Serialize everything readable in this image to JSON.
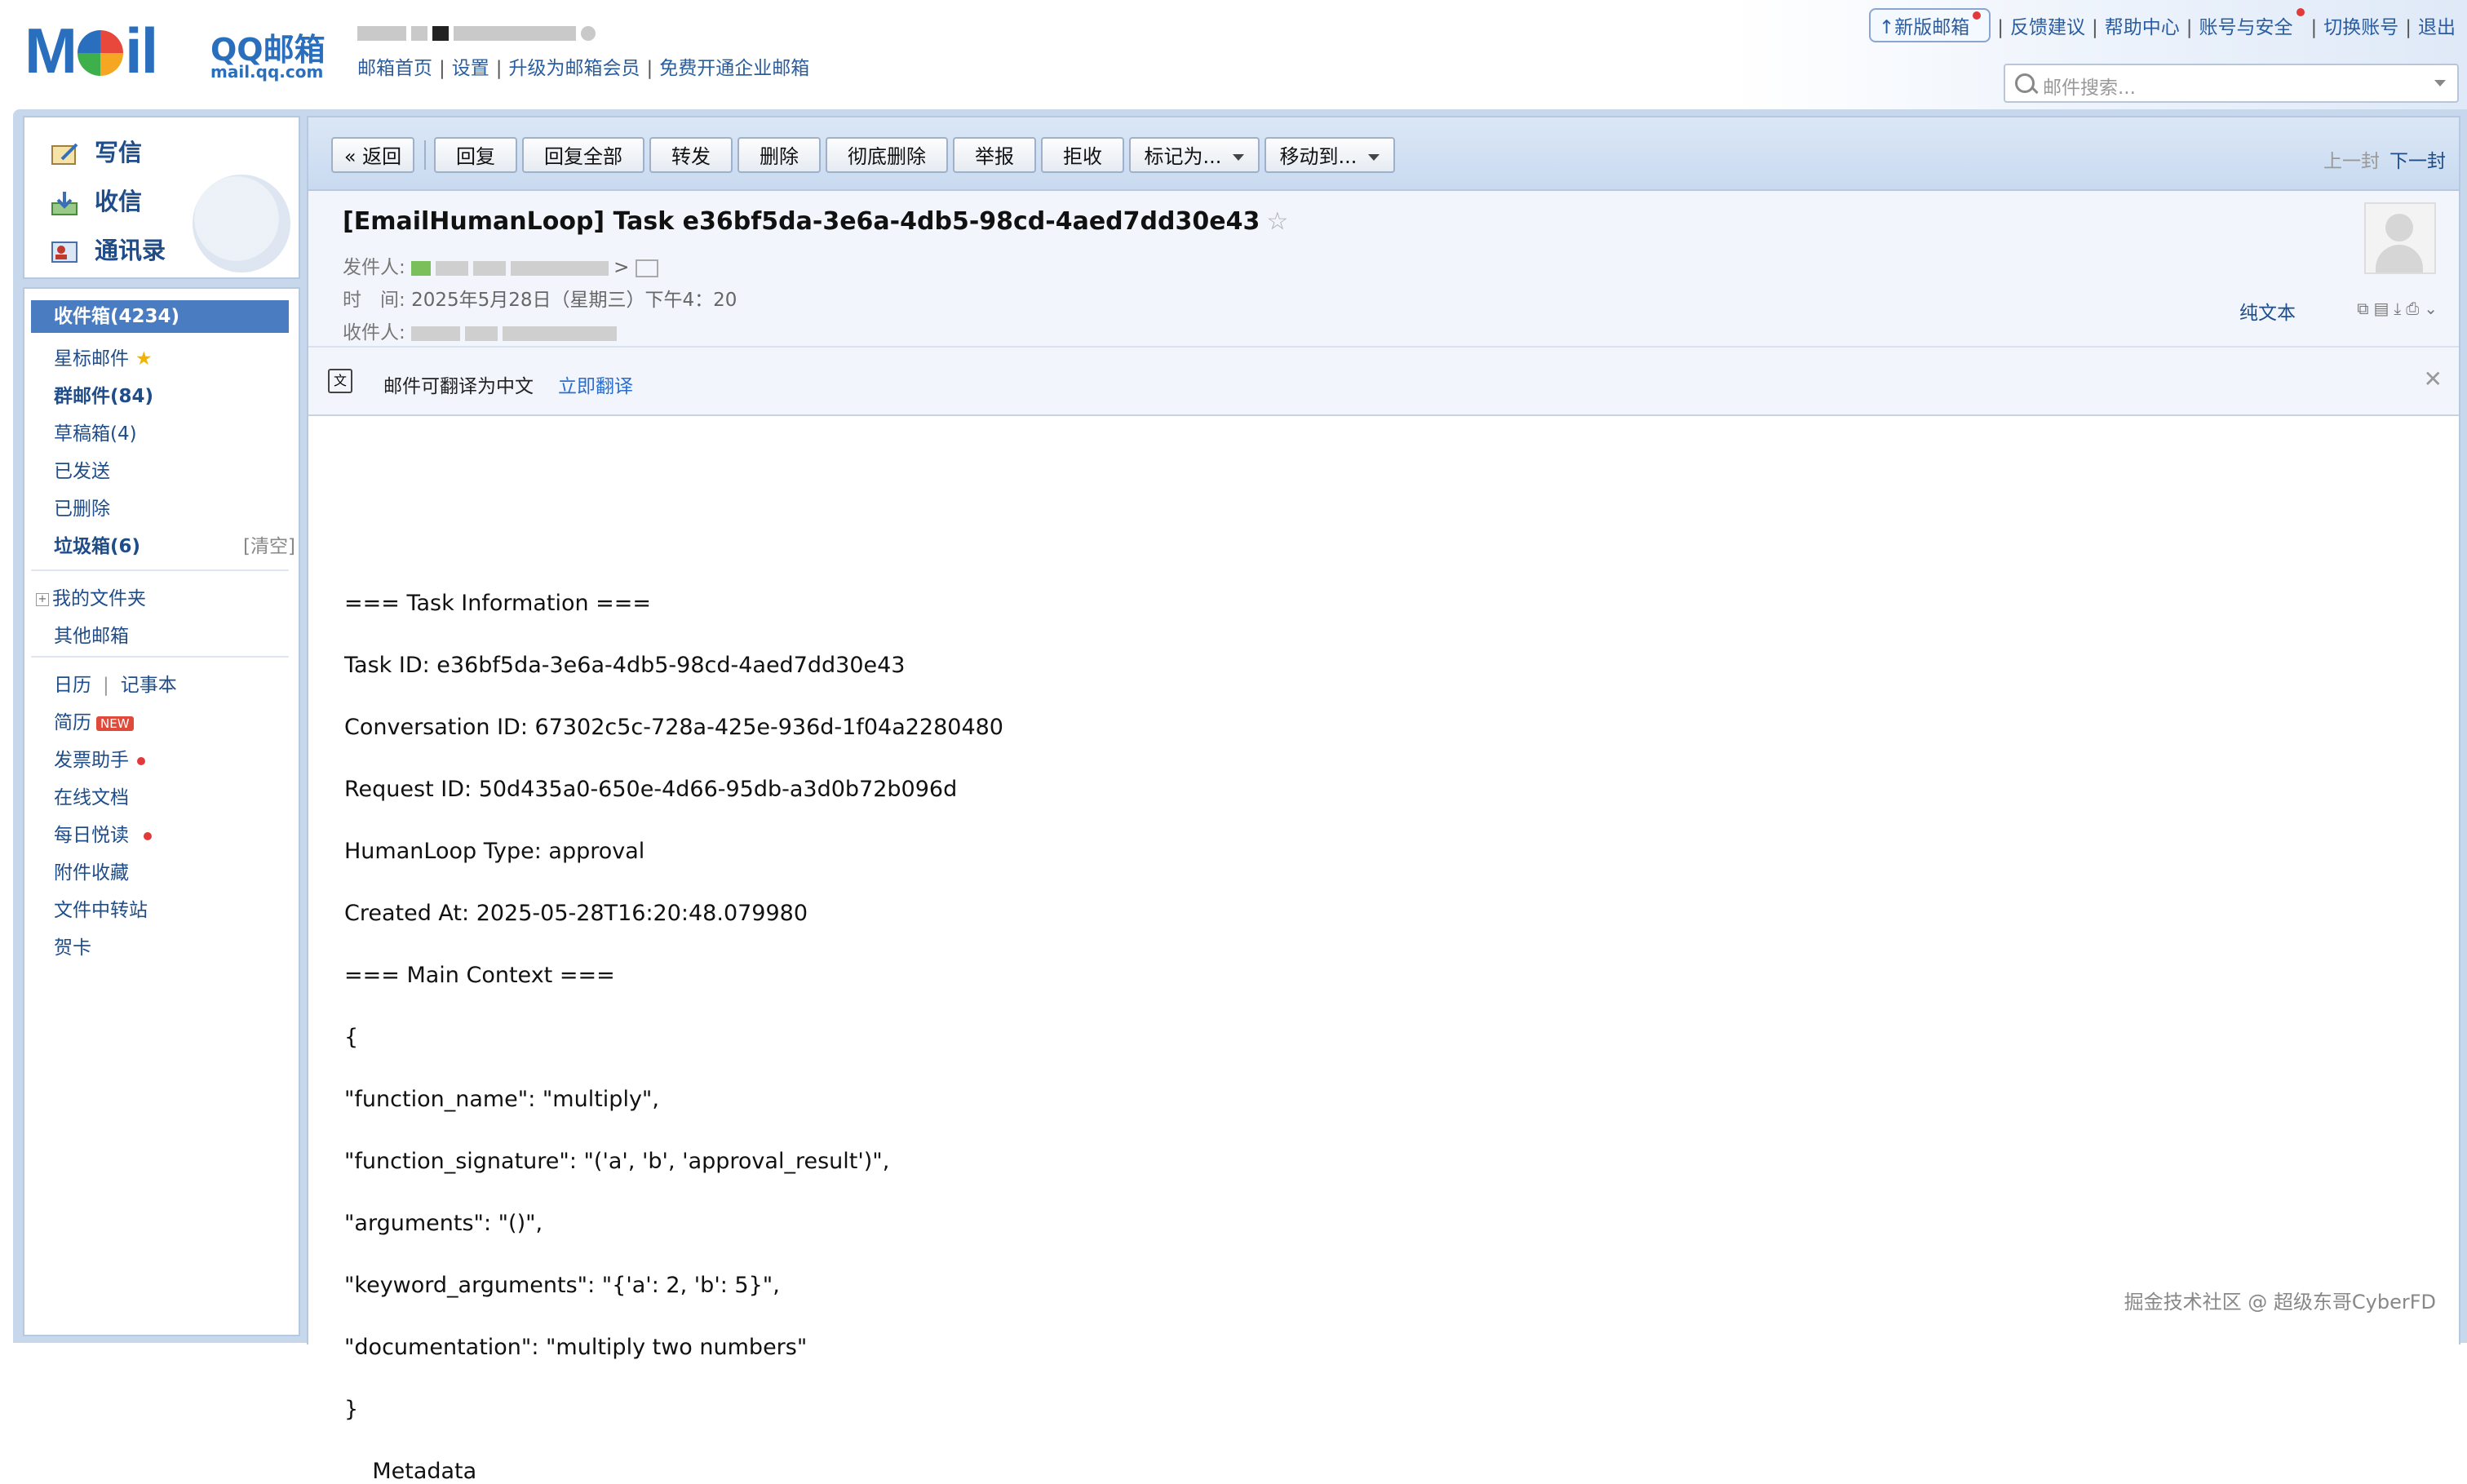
{
  "header": {
    "logo_text": "MOil",
    "brand": "QQ邮箱",
    "brand_url": "mail.qq.com",
    "top_links": [
      "邮箱首页",
      "设置",
      "升级为邮箱会员",
      "免费开通企业邮箱"
    ],
    "right_links": [
      "新版邮箱",
      "反馈建议",
      "帮助中心",
      "账号与安全",
      "切换账号",
      "退出"
    ],
    "search_placeholder": "邮件搜索..."
  },
  "sidebar": {
    "actions": [
      {
        "label": "写信",
        "icon": "compose-icon"
      },
      {
        "label": "收信",
        "icon": "inbox-download-icon"
      },
      {
        "label": "通讯录",
        "icon": "contacts-icon"
      }
    ],
    "folders": [
      {
        "label": "收件箱(4234)",
        "selected": true
      },
      {
        "label": "星标邮件"
      },
      {
        "label": "群邮件(84)",
        "bold": true
      },
      {
        "label": "草稿箱(4)"
      },
      {
        "label": "已发送"
      },
      {
        "label": "已删除"
      },
      {
        "label": "垃圾箱(6)",
        "bold": true,
        "extra": "[清空]"
      }
    ],
    "my_folders": "我的文件夹",
    "other_mailbox": "其他邮箱",
    "apps": {
      "calendar": "日历",
      "notes": "记事本",
      "resume": "简历",
      "resume_badge": "NEW",
      "invoice": "发票助手",
      "docs": "在线文档",
      "daily_read": "每日悦读",
      "attachments": "附件收藏",
      "file_transfer": "文件中转站",
      "cards": "贺卡"
    }
  },
  "toolbar": {
    "buttons": [
      "« 返回",
      "回复",
      "回复全部",
      "转发",
      "删除",
      "彻底删除",
      "举报",
      "拒收",
      "标记为...",
      "移动到..."
    ],
    "prev": "上一封",
    "next": "下一封"
  },
  "email": {
    "subject": "[EmailHumanLoop] Task e36bf5da-3e6a-4db5-98cd-4aed7dd30e43",
    "sender_label": "发件人:",
    "time_label": "时　间:",
    "time_value": "2025年5月28日（星期三）下午4：20",
    "recipient_label": "收件人:",
    "plain_text": "纯文本",
    "translate_text": "邮件可翻译为中文",
    "translate_link": "立即翻译",
    "body_lines": [
      "=== Task Information ===",
      "Task ID: e36bf5da-3e6a-4db5-98cd-4aed7dd30e43",
      "Conversation ID: 67302c5c-728a-425e-936d-1f04a2280480",
      "Request ID: 50d435a0-650e-4d66-95db-a3d0b72b096d",
      "HumanLoop Type: approval",
      "Created At: 2025-05-28T16:20:48.079980",
      "=== Main Context ===",
      "{",
      "\"function_name\": \"multiply\",",
      "\"function_signature\": \"('a', 'b', 'approval_result')\",",
      "\"arguments\": \"()\",",
      "\"keyword_arguments\": \"{'a': 2, 'b': 5}\",",
      "\"documentation\": \"multiply two numbers\"",
      "}",
      "    Metadata"
    ]
  },
  "watermark": "掘金技术社区 @ 超级东哥CyberFD",
  "colors": {
    "link": "#2a5d9f",
    "selected": "#4a7cc1",
    "frame": "#c7d7ec"
  }
}
